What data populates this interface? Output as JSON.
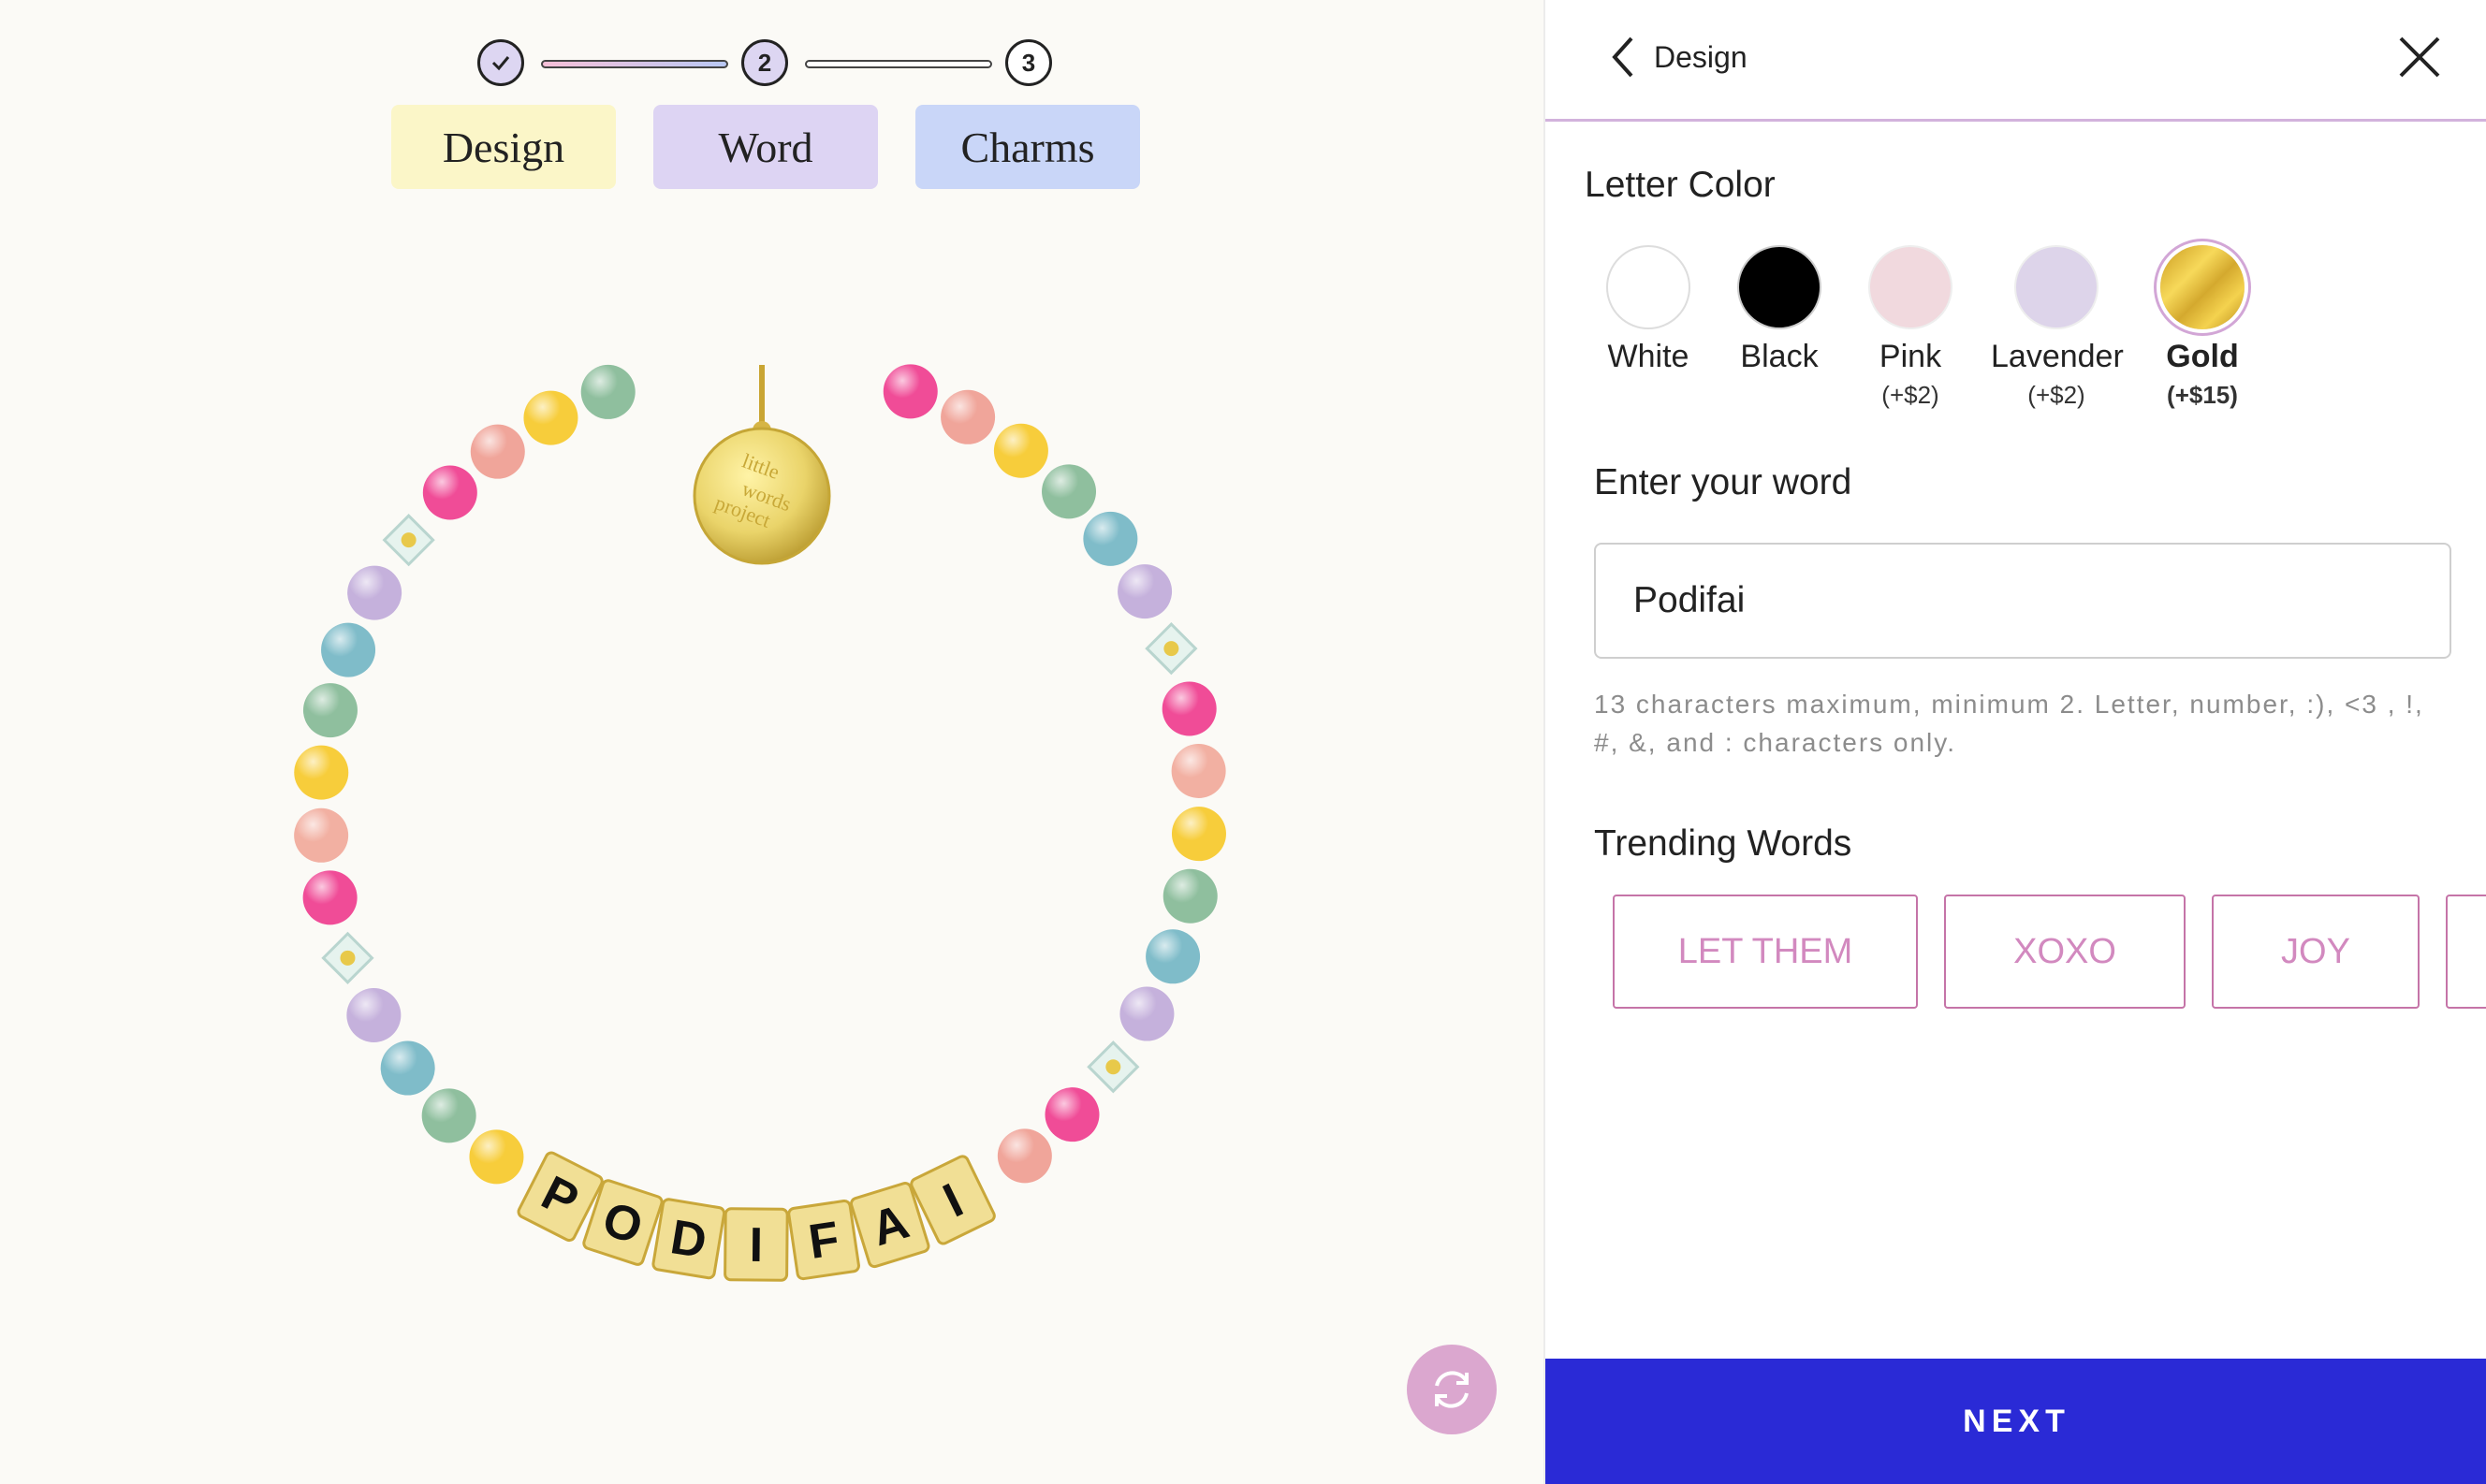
{
  "stepper": {
    "steps": [
      {
        "label": "✓",
        "state": "done"
      },
      {
        "label": "2",
        "state": "active"
      },
      {
        "label": "3",
        "state": "pending"
      }
    ]
  },
  "tabs": [
    {
      "label": "Design",
      "color": "#fbf6c8"
    },
    {
      "label": "Word",
      "color": "#ddd4f3"
    },
    {
      "label": "Charms",
      "color": "#c9d6f8"
    }
  ],
  "bracelet": {
    "charm_text": [
      "little",
      "words",
      "project"
    ],
    "letters": [
      "P",
      "O",
      "D",
      "I",
      "F",
      "A",
      "I"
    ]
  },
  "panel": {
    "back_label": "Design",
    "letter_color": {
      "title": "Letter Color",
      "options": [
        {
          "name": "White",
          "price": "",
          "color": "#ffffff",
          "selected": false
        },
        {
          "name": "Black",
          "price": "",
          "color": "#000000",
          "selected": false
        },
        {
          "name": "Pink",
          "price": "(+$2)",
          "color": "#f1d9de",
          "selected": false
        },
        {
          "name": "Lavender",
          "price": "(+$2)",
          "color": "#ddd4ea",
          "selected": false
        },
        {
          "name": "Gold",
          "price": "(+$15)",
          "color": "#e2b73d",
          "selected": true
        }
      ]
    },
    "word": {
      "title": "Enter your word",
      "value": "Podifai",
      "hint": "13 characters maximum, minimum 2. Letter, number, :), <3 , !, #, &, and : characters only."
    },
    "trending": {
      "title": "Trending Words",
      "words": [
        "LET THEM",
        "XOXO",
        "JOY"
      ]
    },
    "next_label": "NEXT"
  },
  "colors": {
    "accent": "#2a2ad6",
    "trend_border": "#c574a8",
    "trend_text": "#d289bf",
    "refresh": "#dba7cf"
  }
}
